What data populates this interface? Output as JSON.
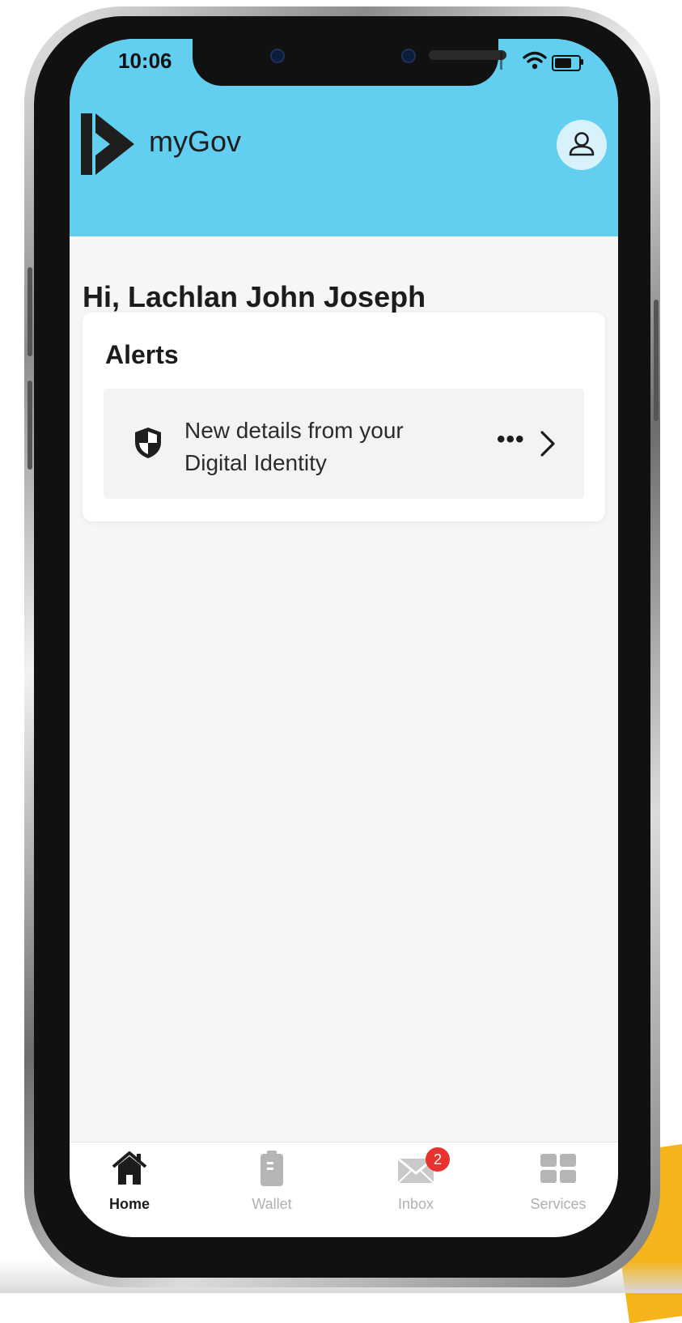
{
  "status_bar": {
    "time": "10:06"
  },
  "header": {
    "brand": "myGov",
    "accent_color": "#63cff0"
  },
  "greeting": "Hi, Lachlan John Joseph",
  "alerts": {
    "title": "Alerts",
    "items": [
      {
        "text": "New details from your Digital Identity",
        "more": "•••",
        "icon": "shield-icon"
      }
    ]
  },
  "tabbar": {
    "tabs": [
      {
        "label": "Home",
        "icon": "home-icon",
        "active": true
      },
      {
        "label": "Wallet",
        "icon": "wallet-icon",
        "active": false
      },
      {
        "label": "Inbox",
        "icon": "mail-icon",
        "active": false,
        "badge": "2"
      },
      {
        "label": "Services",
        "icon": "grid-icon",
        "active": false
      }
    ]
  },
  "badge_color": "#e8322e"
}
